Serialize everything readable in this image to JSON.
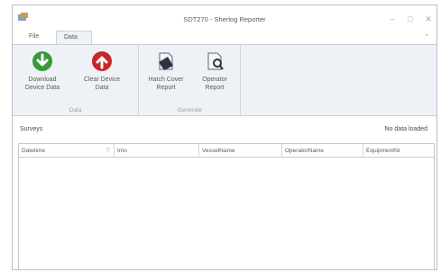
{
  "window": {
    "title": "SDT270 - Sherlog Reporter",
    "controls": {
      "minimize": "–",
      "maximize": "□",
      "close": "✕"
    }
  },
  "tabs": [
    {
      "label": "File"
    },
    {
      "label": "Data"
    }
  ],
  "ribbon": {
    "collapse_glyph": "⌃",
    "groups": [
      {
        "label": "Data",
        "buttons": [
          {
            "label_line1": "Download",
            "label_line2": "Device Data",
            "icon": "download-icon"
          },
          {
            "label_line1": "Clear Device",
            "label_line2": "Data",
            "icon": "clear-icon"
          }
        ]
      },
      {
        "label": "Generate",
        "buttons": [
          {
            "label_line1": "Hatch Cover",
            "label_line2": "Report",
            "icon": "hatch-report-icon"
          },
          {
            "label_line1": "Operator",
            "label_line2": "Report",
            "icon": "operator-report-icon"
          }
        ]
      }
    ]
  },
  "surveys": {
    "label": "Surveys",
    "status": "No data loaded"
  },
  "grid": {
    "columns": [
      "Datetime",
      "Imo",
      "VesselName",
      "OperatorName",
      "EquipmentNr"
    ],
    "sort_glyph": "▽"
  },
  "colors": {
    "download_green": "#3a9a3a",
    "clear_red": "#c8262c",
    "ribbon_bg": "#eef2f6"
  }
}
